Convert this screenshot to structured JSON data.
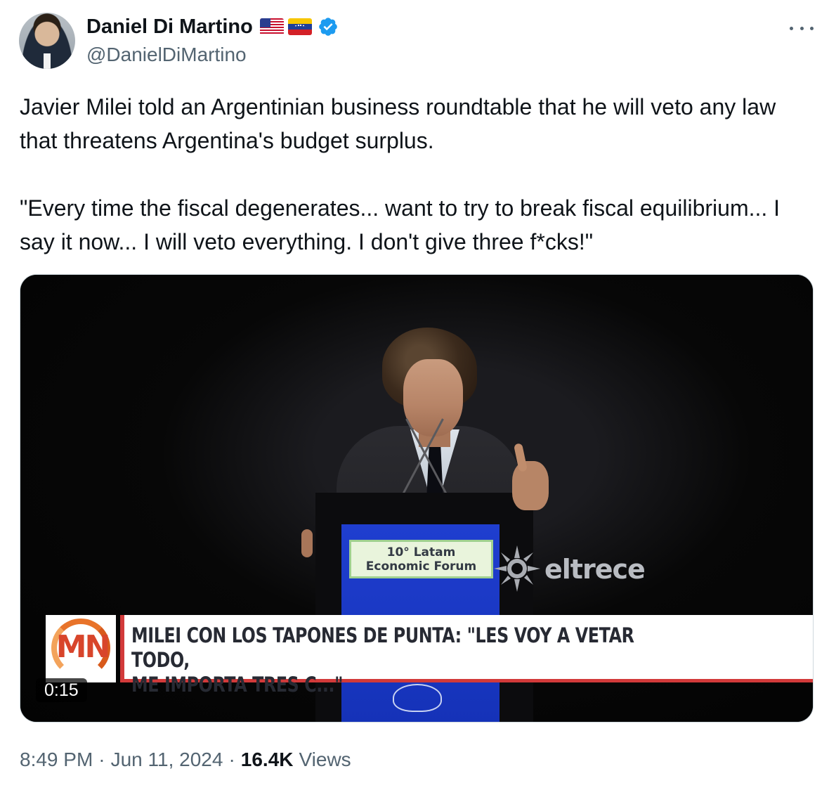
{
  "author": {
    "display_name": "Daniel Di Martino",
    "handle": "@DanielDiMartino",
    "flags": [
      "us-flag",
      "venezuela-flag"
    ],
    "verified": true,
    "verified_color": "#1d9bf0"
  },
  "tweet": {
    "text": "Javier Milei told an Argentinian business roundtable that he will veto any law that threatens Argentina's budget surplus.\n\n\"Every time the fiscal degenerates... want to try to break fiscal equilibrium... I say it now... I will veto everything. I don't give three f*cks!\""
  },
  "media": {
    "type": "video",
    "duration": "0:15",
    "sign_line1": "10° Latam",
    "sign_line2": "Economic Forum",
    "watermark": "eltrece",
    "channel_logo_text": "MN",
    "headline": "MILEI CON LOS TAPONES DE PUNTA: \"LES VOY A VETAR TODO,\nME IMPORTA TRES C...\""
  },
  "meta": {
    "time": "8:49 PM",
    "separator": "·",
    "date": "Jun 11, 2024",
    "views_count": "16.4K",
    "views_label": "Views"
  },
  "colors": {
    "text_primary": "#0f1419",
    "text_secondary": "#536471",
    "border": "#cfd9de",
    "headline_accent": "#d23a3a",
    "podium_blue": "#1f3ecf"
  }
}
